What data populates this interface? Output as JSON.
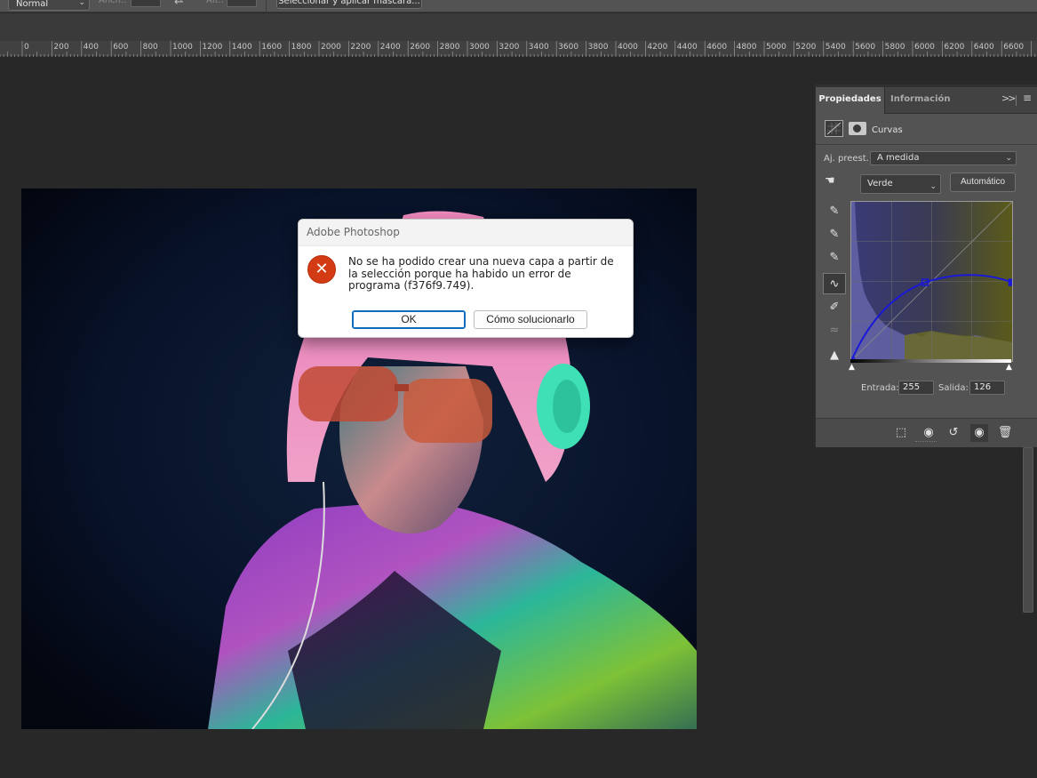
{
  "options_bar": {
    "blend_mode": "Normal",
    "width_label": "Anch.:",
    "height_label": "Alt.:",
    "swap_icon": "swap-arrow-icon",
    "select_mask_button": "Seleccionar y aplicar máscara..."
  },
  "ruler": {
    "labels": [
      "0",
      "0",
      "200",
      "400",
      "600",
      "800",
      "1000",
      "1200",
      "1400",
      "1600",
      "1800",
      "2000",
      "2200",
      "2400",
      "2600",
      "2800",
      "3000",
      "3200",
      "3400",
      "3600",
      "3800",
      "4000",
      "4200",
      "4400",
      "4600",
      "4800",
      "5000",
      "5200",
      "5400",
      "5600",
      "5800",
      "6000",
      "6200",
      "6400",
      "6600"
    ]
  },
  "dialog": {
    "title": "Adobe Photoshop",
    "icon": "error-icon",
    "message": "No se ha podido crear una nueva capa a partir de la selección porque ha habido un error de programa (f376f9.749).",
    "ok_label": "OK",
    "fix_label": "Cómo solucionarlo"
  },
  "properties_panel": {
    "tabs": [
      {
        "label": "Propiedades",
        "active": true
      },
      {
        "label": "Información",
        "active": false
      }
    ],
    "adjustment_title": "Curvas",
    "preset_label": "Aj. preest.:",
    "preset_value": "A medida",
    "channel_value": "Verde",
    "auto_label": "Automático",
    "input_label": "Entrada:",
    "input_value": "255",
    "output_label": "Salida:",
    "output_value": "126",
    "curve_points": [
      {
        "input": 0,
        "output": 0
      },
      {
        "input": 117,
        "output": 126
      },
      {
        "input": 255,
        "output": 126
      }
    ],
    "curve_color": "#1a1ad6"
  },
  "colors": {
    "dialog_error": "#d33b14",
    "ok_border": "#0f6cbd",
    "panel_bg": "#535353",
    "canvas_bg": "#282828"
  }
}
